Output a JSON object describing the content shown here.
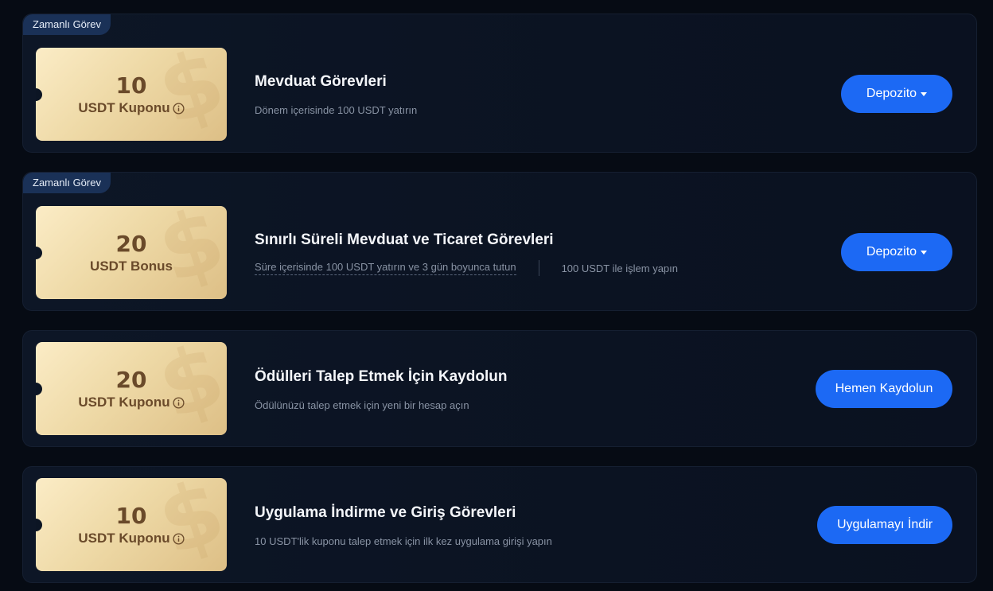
{
  "tasks": [
    {
      "tag": "Zamanlı Görev",
      "amount": "10",
      "unit": "USDT Kuponu",
      "has_info": true,
      "title": "Mevduat Görevleri",
      "description": "Dönem içerisinde 100 USDT yatırın",
      "button_label": "Depozito",
      "button_has_caret": true
    },
    {
      "tag": "Zamanlı Görev",
      "amount": "20",
      "unit": "USDT Bonus",
      "has_info": false,
      "title": "Sınırlı Süreli Mevduat ve Ticaret Görevleri",
      "description": "Süre içerisinde 100 USDT yatırın ve 3 gün boyunca tutun",
      "description_secondary": "100 USDT ile işlem yapın",
      "button_label": "Depozito",
      "button_has_caret": true
    },
    {
      "amount": "20",
      "unit": "USDT Kuponu",
      "has_info": true,
      "title": "Ödülleri Talep Etmek İçin Kaydolun",
      "description": "Ödülünüzü talep etmek için yeni bir hesap açın",
      "button_label": "Hemen Kaydolun",
      "button_has_caret": false
    },
    {
      "amount": "10",
      "unit": "USDT Kuponu",
      "has_info": true,
      "title": "Uygulama İndirme ve Giriş Görevleri",
      "description": "10 USDT'lik kuponu talep etmek için ilk kez uygulama girişi yapın",
      "button_label": "Uygulamayı İndir",
      "button_has_caret": false
    }
  ],
  "colors": {
    "background": "#060b14",
    "card": "#0d1626",
    "button": "#1c69f4",
    "tag": "#1a3157",
    "coupon_text": "#6a4a2a"
  }
}
